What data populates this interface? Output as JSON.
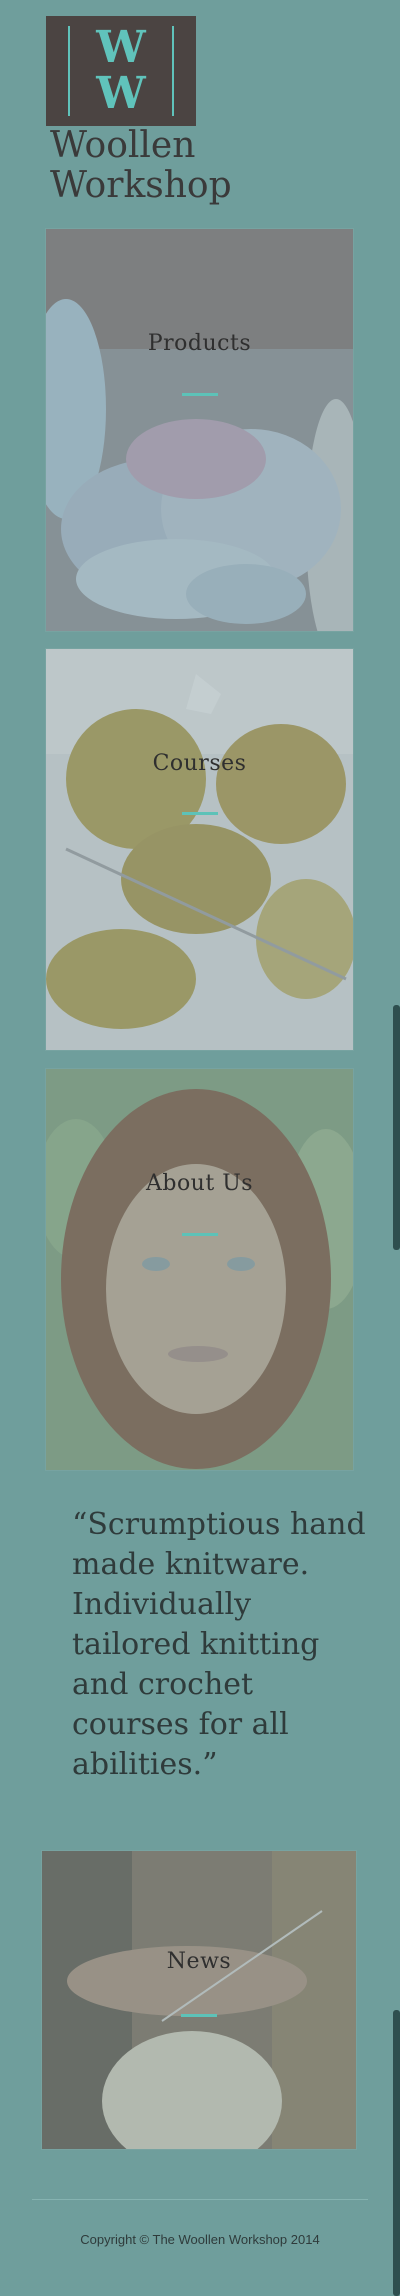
{
  "brand": {
    "logo_letter": "W",
    "title": "Woollen Workshop",
    "accent_color": "#5dc2b8",
    "logo_bg_color": "#4b4442"
  },
  "sections": [
    {
      "label": "Products"
    },
    {
      "label": "Courses"
    },
    {
      "label": "About Us"
    },
    {
      "label": "News"
    }
  ],
  "quote": "“Scrumptious hand made knitware. Individually tailored knitting and crochet courses for all abilities.”",
  "footer": {
    "copyright": "Copyright © The Woollen Workshop 2014"
  },
  "theme": {
    "background": "#6f9e9c"
  }
}
